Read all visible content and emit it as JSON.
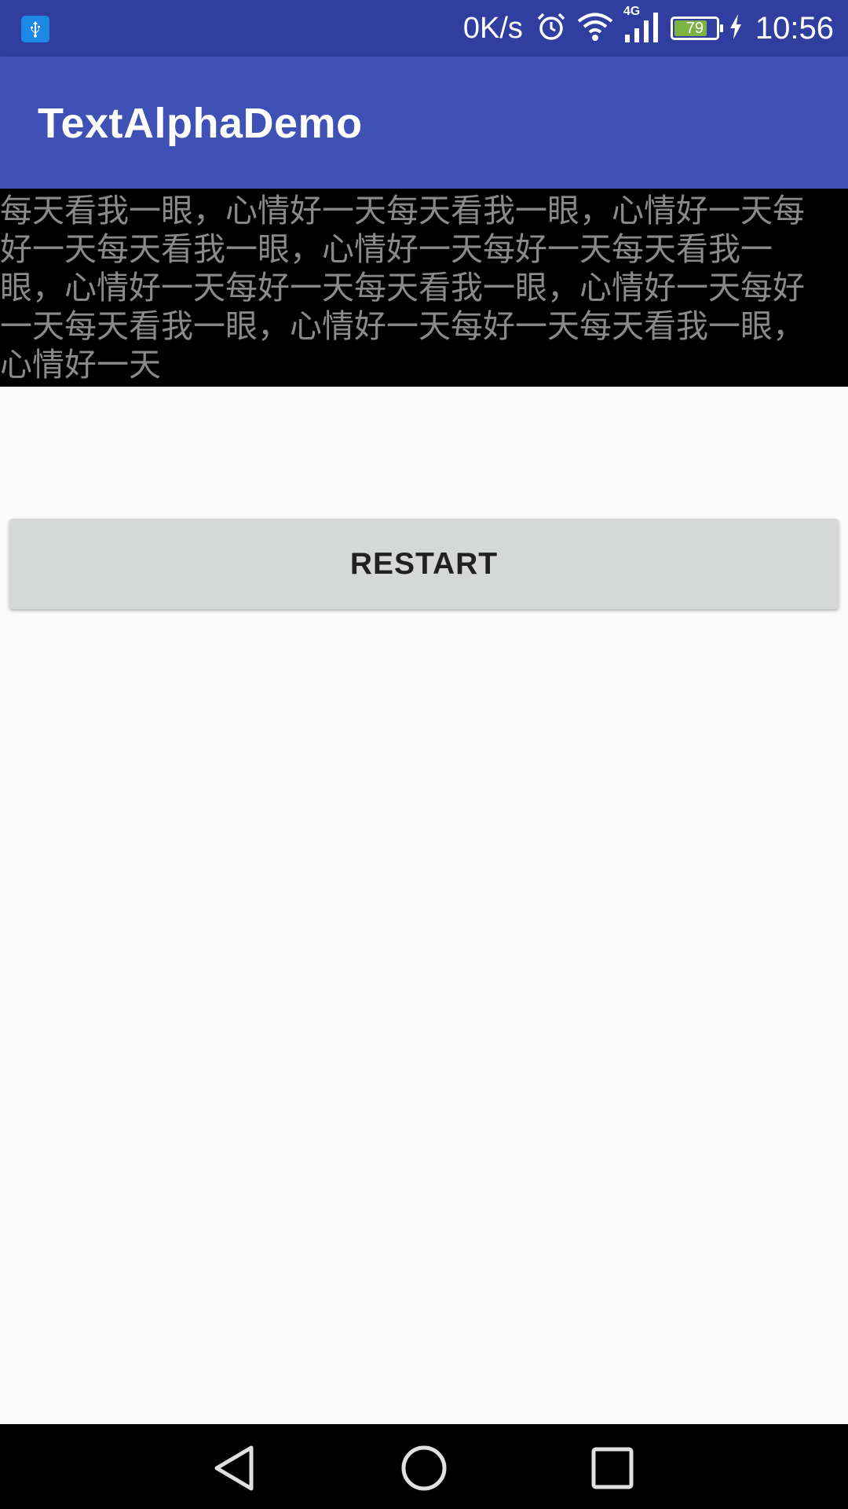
{
  "status_bar": {
    "net_speed": "0K/s",
    "network_type": "4G",
    "battery_level": "79",
    "battery_fraction": 0.79,
    "time": "10:56",
    "icons": [
      "usb-icon",
      "alarm-icon",
      "wifi-icon",
      "signal-icon",
      "battery-icon",
      "charging-icon"
    ]
  },
  "app_bar": {
    "title": "TextAlphaDemo"
  },
  "text_panel": {
    "lines": [
      "每天看我一眼，心情好一天每天看我一眼，心情好一天每",
      "好一天每天看我一眼，心情好一天每好一天每天看我一",
      "眼，心情好一天每好一天每天看我一眼，心情好一天每好",
      "一天每天看我一眼，心情好一天每好一天每天看我一眼，",
      "心情好一天"
    ]
  },
  "main": {
    "restart_label": "RESTART"
  },
  "nav_bar": {
    "buttons": [
      "back-icon",
      "home-icon",
      "recents-icon"
    ]
  },
  "colors": {
    "status_bar": "#303f9f",
    "app_bar": "#3f51b5",
    "text_panel_bg": "#000000",
    "text_dim": "#8a8a8a",
    "button": "#d6d7d7",
    "page_bg": "#fafafa"
  }
}
